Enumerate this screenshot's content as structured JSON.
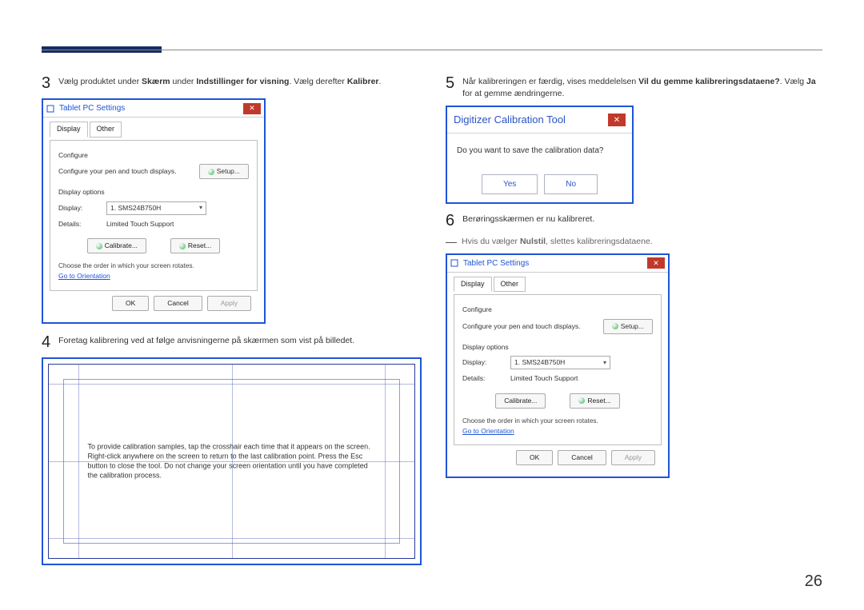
{
  "page_number": "26",
  "steps": {
    "s3_num": "3",
    "s3_text_a": "Vælg produktet under ",
    "s3_bold_a": "Skærm",
    "s3_text_b": " under ",
    "s3_bold_b": "Indstillinger for visning",
    "s3_text_c": ". Vælg derefter ",
    "s3_bold_c": "Kalibrer",
    "s3_text_d": ".",
    "s4_num": "4",
    "s4_text": "Foretag kalibrering ved at følge anvisningerne på skærmen som vist på billedet.",
    "s5_num": "5",
    "s5_text_a": "Når kalibreringen er færdig, vises meddelelsen ",
    "s5_bold_a": "Vil du gemme kalibreringsdataene?",
    "s5_text_b": ". Vælg ",
    "s5_bold_b": "Ja",
    "s5_text_c": " for at gemme ændringerne.",
    "s6_num": "6",
    "s6_text": "Berøringsskærmen er nu kalibreret."
  },
  "note": {
    "a": "Hvis du vælger ",
    "b": "Nulstil",
    "c": ", slettes kalibreringsdataene."
  },
  "tablet_pc": {
    "title": "Tablet PC Settings",
    "tab_display": "Display",
    "tab_other": "Other",
    "configure": "Configure",
    "configure_desc": "Configure your pen and touch displays.",
    "setup_btn": "Setup...",
    "display_options": "Display options",
    "display_label": "Display:",
    "display_value": "1. SMS24B750H",
    "details_label": "Details:",
    "details_value": "Limited Touch Support",
    "calibrate_btn": "Calibrate...",
    "reset_btn": "Reset...",
    "rotate_hint": "Choose the order in which your screen rotates.",
    "orientation_link": "Go to Orientation",
    "ok": "OK",
    "cancel": "Cancel",
    "apply": "Apply"
  },
  "calib_msg": "To provide calibration samples, tap the crosshair each time that it appears on the screen.\nRight-click anywhere on the screen to return to the last calibration point. Press the Esc button to close the tool. Do not change your screen orientation until you have completed the calibration process.",
  "digitizer": {
    "title": "Digitizer Calibration Tool",
    "question": "Do you want to save the calibration data?",
    "yes": "Yes",
    "no": "No"
  }
}
